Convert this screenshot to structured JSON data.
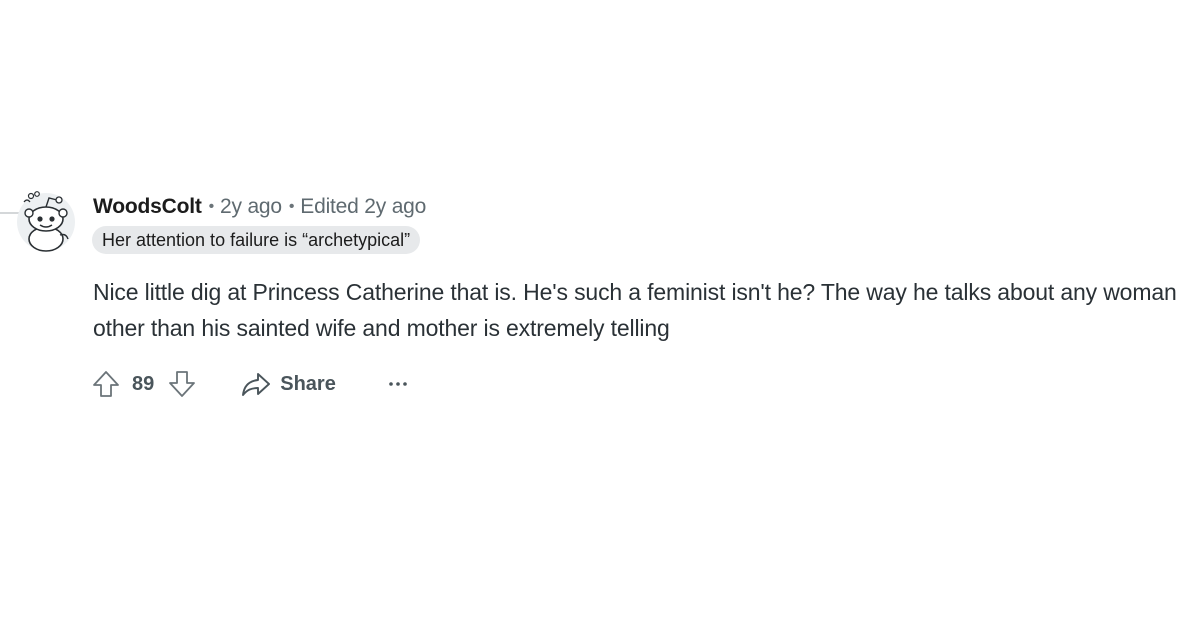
{
  "comment": {
    "username": "WoodsColt",
    "posted_time": "2y ago",
    "edited_text": "Edited 2y ago",
    "separator": "•",
    "flair": "Her attention to failure is “archetypical”",
    "body": "Nice little dig at Princess Catherine that is. He's such a feminist isn't he? The way he talks about any woman other than his sainted wife and mother is extremely telling",
    "avatar_icon": "snoo-avatar-icon",
    "actions": {
      "upvote_icon": "upvote-arrow-icon",
      "vote_count": "89",
      "downvote_icon": "downvote-arrow-icon",
      "share_icon": "share-arrow-icon",
      "share_label": "Share",
      "more_icon": "ellipsis-icon"
    }
  },
  "colors": {
    "text": "#1c1c1c",
    "muted_text": "#5f6a70",
    "flair_background": "#e7e9eb",
    "thread_line": "#d4d7d9"
  }
}
